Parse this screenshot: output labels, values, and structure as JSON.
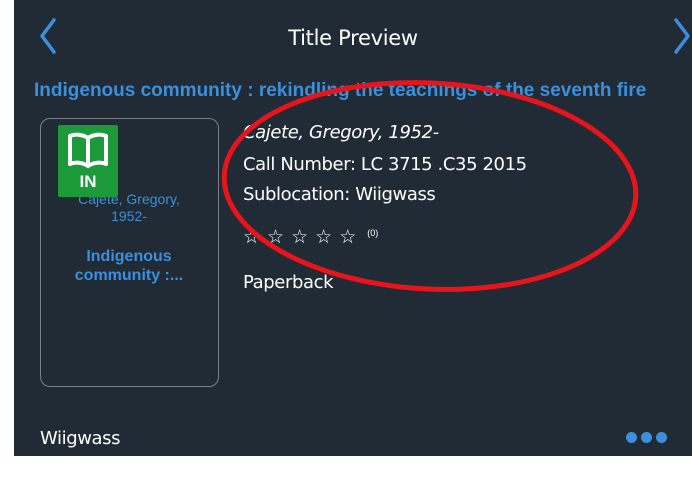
{
  "header": {
    "title": "Title Preview",
    "prev_icon": "chevron-left-icon",
    "next_icon": "chevron-right-icon"
  },
  "book": {
    "title": "Indigenous community : rekindling the teachings of the seventh fire",
    "author": "Cajete, Gregory, 1952-",
    "call_number": "Call Number: LC 3715 .C35 2015",
    "sublocation": "Sublocation: Wiigwass",
    "rating_stars": 5,
    "rating_count": "(0)",
    "format": "Paperback"
  },
  "cover": {
    "author_line1": "Cajete, Gregory,",
    "author_line2": "1952-",
    "title_line1": "Indigenous",
    "title_line2": "community :..."
  },
  "badge": {
    "label": "IN",
    "icon": "book-icon",
    "color": "#1c9a3a"
  },
  "footer": {
    "location": "Wiigwass",
    "more_icon": "more-dots-icon"
  },
  "colors": {
    "panel_bg": "#212b36",
    "link": "#3b8fdd",
    "annotation": "#e8141c"
  }
}
